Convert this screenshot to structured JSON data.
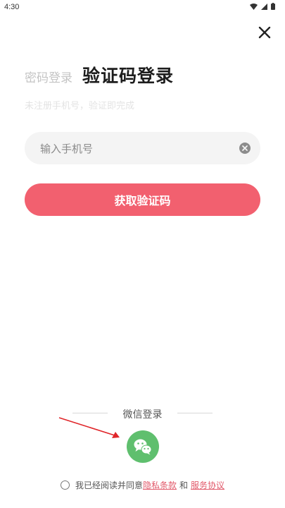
{
  "status_bar": {
    "time": "4:30"
  },
  "login": {
    "tab_password": "密码登录",
    "tab_code": "验证码登录",
    "subtitle": "未注册手机号，验证即完成",
    "phone_placeholder": "输入手机号",
    "get_code_label": "获取验证码",
    "wechat_label": "微信登录"
  },
  "agreement": {
    "prefix": "我已经阅读并同意",
    "privacy_link": "隐私条款",
    "and": "和",
    "service_link": "服务协议"
  },
  "colors": {
    "primary_button": "#f2606f",
    "wechat_green": "#5fbf6e",
    "link": "#e25a6b"
  },
  "icons": {
    "close": "close-icon",
    "clear": "clear-icon",
    "wechat": "wechat-icon"
  }
}
